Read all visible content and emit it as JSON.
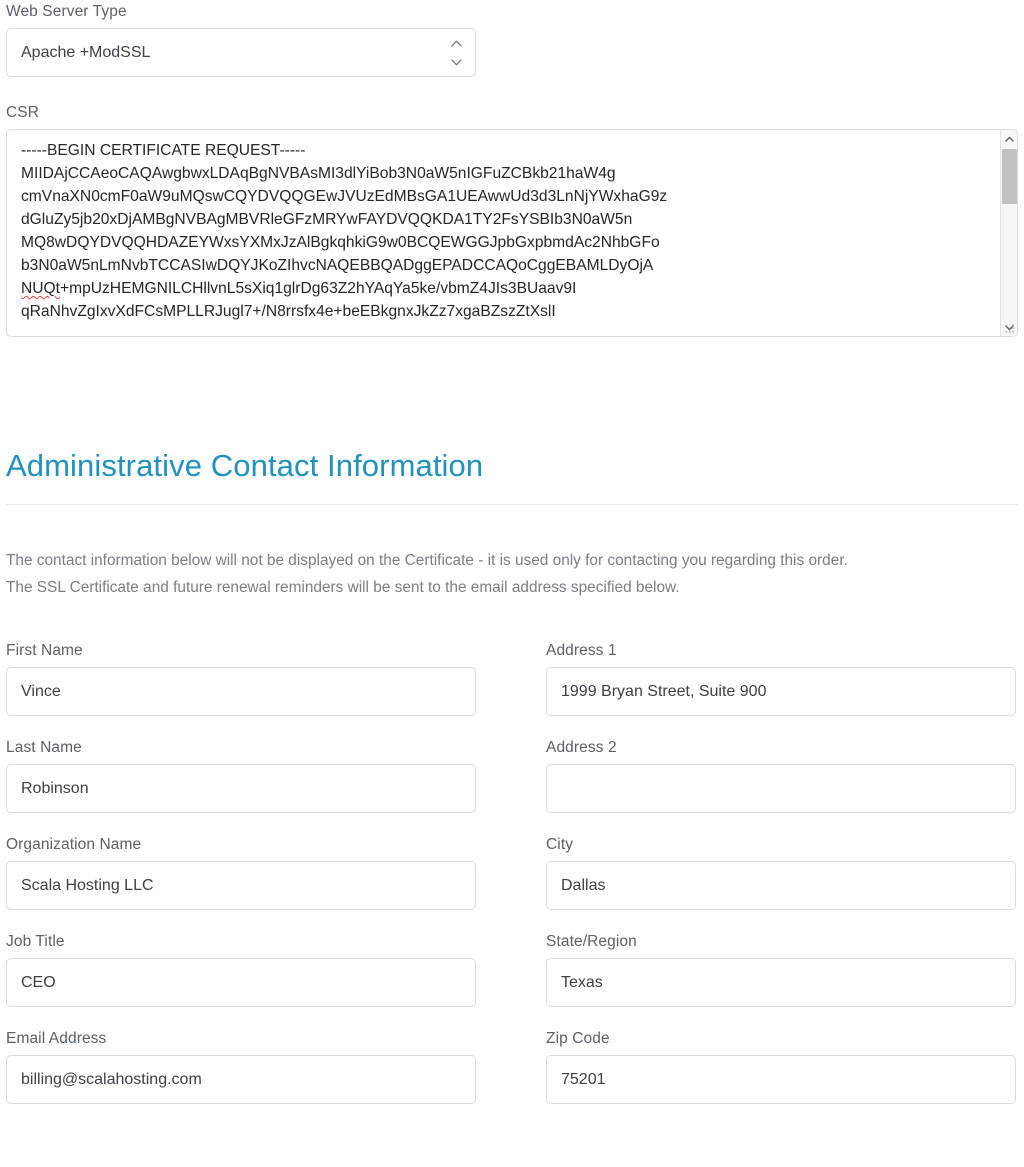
{
  "web_server_type": {
    "label": "Web Server Type",
    "value": "Apache +ModSSL",
    "icon": "spinner-updown-icon"
  },
  "csr": {
    "label": "CSR",
    "line1": "-----BEGIN CERTIFICATE REQUEST-----",
    "line2": "MIIDAjCCAeoCAQAwgbwxLDAqBgNVBAsMI3dlYiBob3N0aW5nIGFuZCBkb21haW4g",
    "line3": "cmVnaXN0cmF0aW9uMQswCQYDVQQGEwJVUzEdMBsGA1UEAwwUd3d3LnNjYWxhaG9z",
    "line4": "dGluZy5jb20xDjAMBgNVBAgMBVRleGFzMRYwFAYDVQQKDA1TY2FsYSBIb3N0aW5n",
    "line5": "MQ8wDQYDVQQHDAZEYWxsYXMxJzAlBgkqhkiG9w0BCQEWGGJpbGxpbmdAc2NhbGFo",
    "line6": "b3N0aW5nLmNvbTCCASIwDQYJKoZIhvcNAQEBBQADggEPADCCAQoCggEBAMLDyOjA",
    "line7_spell": "NUQt",
    "line7_rest": "+mpUzHEMGNILCHllvnL5sXiq1glrDg63Z2hYAqYa5ke/vbmZ4JIs3BUaav9I",
    "line8": "qRaNhvZgIxvXdFCsMPLLRJugl7+/N8rrsfx4e+beEBkgnxJkZz7xgaBZszZtXslI",
    "scrollbar": {
      "up_icon": "chevron-up-icon",
      "down_icon": "chevron-down-icon"
    },
    "resize_icon": "resize-grip-icon"
  },
  "admin_section": {
    "title": "Administrative Contact Information",
    "description_line1": "The contact information below will not be displayed on the Certificate - it is used only for contacting you regarding this order.",
    "description_line2": "The SSL Certificate and future renewal reminders will be sent to the email address specified below.",
    "accent_color": "#2092c0"
  },
  "form": {
    "fields": [
      {
        "label": "First Name",
        "value": "Vince",
        "name": "first-name"
      },
      {
        "label": "Address 1",
        "value": "1999 Bryan Street, Suite 900",
        "name": "address-1"
      },
      {
        "label": "Last Name",
        "value": "Robinson",
        "name": "last-name"
      },
      {
        "label": "Address 2",
        "value": "",
        "name": "address-2"
      },
      {
        "label": "Organization Name",
        "value": "Scala Hosting LLC",
        "name": "organization-name"
      },
      {
        "label": "City",
        "value": "Dallas",
        "name": "city"
      },
      {
        "label": "Job Title",
        "value": "CEO",
        "name": "job-title"
      },
      {
        "label": "State/Region",
        "value": "Texas",
        "name": "state-region"
      },
      {
        "label": "Email Address",
        "value": "billing@scalahosting.com",
        "name": "email-address"
      },
      {
        "label": "Zip Code",
        "value": "75201",
        "name": "zip-code"
      }
    ]
  }
}
